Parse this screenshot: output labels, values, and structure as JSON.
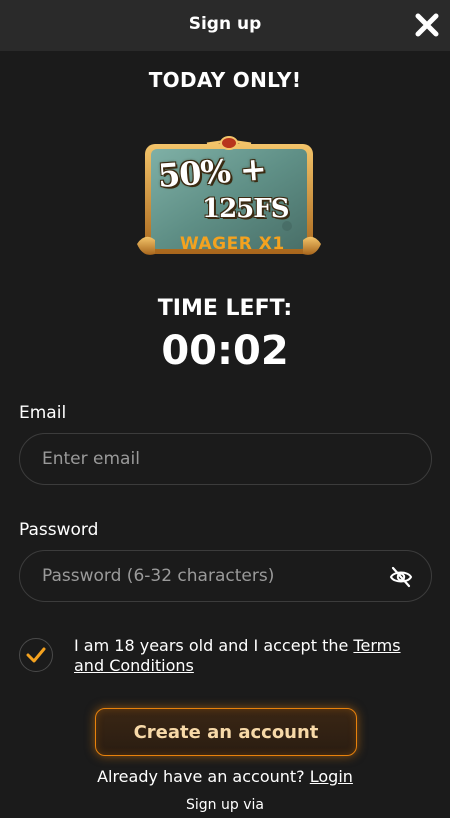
{
  "header": {
    "title": "Sign up",
    "close_icon": "close-icon"
  },
  "promo": {
    "title": "TODAY ONLY!",
    "banner_line1": "50% +",
    "banner_line2": "125FS",
    "banner_line3": "WAGER X1"
  },
  "timer": {
    "label": "TIME LEFT:",
    "value": "00:02"
  },
  "form": {
    "email_label": "Email",
    "email_placeholder": "Enter email",
    "email_value": "",
    "password_label": "Password",
    "password_placeholder": "Password (6-32 characters)",
    "password_value": "",
    "password_toggle_icon": "eye-off-icon",
    "consent_checked": true,
    "consent_text": "I am 18 years old and I accept the ",
    "terms_link": "Terms and Conditions",
    "submit_label": "Create an account"
  },
  "footer": {
    "login_prompt": "Already have an account?",
    "login_link": "Login",
    "signup_via": "Sign up via"
  },
  "colors": {
    "background": "#1b1b1b",
    "header_bg": "#2a2a2a",
    "accent": "#e8820c",
    "banner_text_accent": "#f4a21f"
  }
}
